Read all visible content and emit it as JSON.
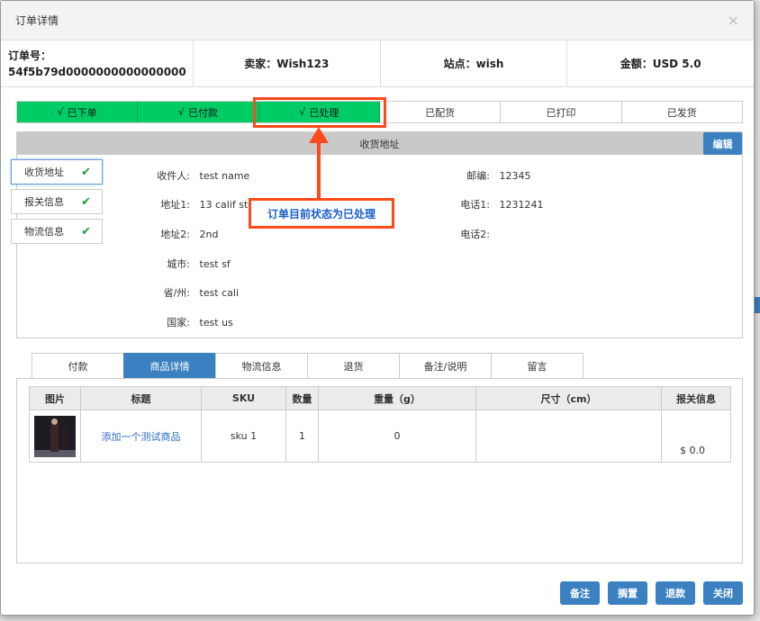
{
  "modal": {
    "title": "订单详情"
  },
  "summary": {
    "order_no": "订单号：54f5b79d0000000000000000",
    "seller": "卖家：Wish123",
    "site": "站点：wish",
    "amount": "金额：USD 5.0"
  },
  "steps": [
    {
      "label": "已下单",
      "done": true,
      "check": "√"
    },
    {
      "label": "已付款",
      "done": true,
      "check": "√"
    },
    {
      "label": "已处理",
      "done": true,
      "check": "√"
    },
    {
      "label": "已配货",
      "done": false
    },
    {
      "label": "已打印",
      "done": false
    },
    {
      "label": "已发货",
      "done": false
    }
  ],
  "address": {
    "header": "收货地址",
    "edit_label": "编辑",
    "fields": {
      "recipient_label": "收件人:",
      "recipient": "test name",
      "addr1_label": "地址1:",
      "addr1": "13 calif st",
      "addr2_label": "地址2:",
      "addr2": "2nd",
      "city_label": "城市:",
      "city": "test sf",
      "state_label": "省/州:",
      "state": "test cali",
      "country_label": "国家:",
      "country": "test us",
      "zip_label": "邮编:",
      "zip": "12345",
      "phone1_label": "电话1:",
      "phone1": "1231241",
      "phone2_label": "电话2:",
      "phone2": ""
    }
  },
  "side_tabs": [
    {
      "label": "收货地址",
      "check": "✔"
    },
    {
      "label": "报关信息",
      "check": "✔"
    },
    {
      "label": "物流信息",
      "check": "✔"
    }
  ],
  "callout": {
    "text": "订单目前状态为已处理"
  },
  "tabs": [
    "付款",
    "商品详情",
    "物流信息",
    "退货",
    "备注/说明",
    "留言"
  ],
  "items_table": {
    "headers": [
      "图片",
      "标题",
      "SKU",
      "数量",
      "重量（g）",
      "尺寸（cm）",
      "报关信息"
    ],
    "rows": [
      {
        "title": "添加一个测试商品",
        "sku": "sku 1",
        "qty": "1",
        "weight": "0",
        "size": "",
        "customs": "$ 0.0"
      }
    ]
  },
  "footer": {
    "note": "备注",
    "hold": "搁置",
    "refund": "退款",
    "close": "关闭"
  },
  "colors": {
    "step_done": "#00cc66",
    "primary": "#3b80c0",
    "annotation": "#ff4a1c"
  }
}
